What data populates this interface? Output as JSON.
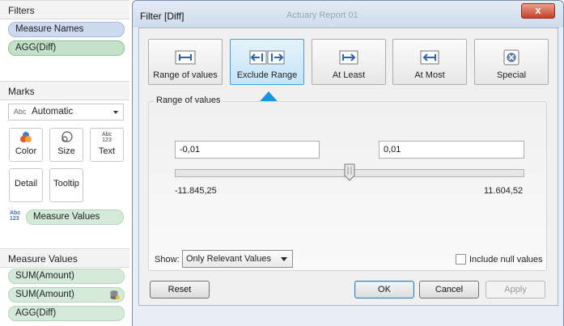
{
  "left_panel": {
    "filters": {
      "title": "Filters",
      "pills": [
        "Measure Names",
        "AGG(Diff)"
      ]
    },
    "marks": {
      "title": "Marks",
      "type_select": {
        "prefix": "Abc",
        "value": "Automatic"
      },
      "buttons": {
        "color": "Color",
        "size": "Size",
        "text": "Text",
        "text_icon_top": "Abc",
        "text_icon_bottom": "123",
        "detail": "Detail",
        "tooltip": "Tooltip"
      },
      "measure_values_abc_top": "Abc",
      "measure_values_abc_bottom": "123",
      "measure_values_pill": "Measure Values"
    },
    "measure_values": {
      "title": "Measure Values",
      "pills": [
        "SUM(Amount)",
        "SUM(Amount)",
        "AGG(Diff)"
      ]
    }
  },
  "dialog": {
    "title": "Filter [Diff]",
    "ghost_title": "Actuary Report 01",
    "close_label": "x",
    "tabs": [
      {
        "label": "Range of values",
        "selected": false
      },
      {
        "label": "Exclude Range",
        "selected": true
      },
      {
        "label": "At Least",
        "selected": false
      },
      {
        "label": "At Most",
        "selected": false
      },
      {
        "label": "Special",
        "selected": false
      }
    ],
    "range_group": {
      "label": "Range of values",
      "min_input": "-0,01",
      "max_input": "0,01",
      "slider_min": "-11.845,25",
      "slider_max": "11.604,52",
      "thumb_position_fraction": 0.5
    },
    "show": {
      "label": "Show:",
      "value": "Only Relevant Values"
    },
    "include_null": {
      "label": "Include null values",
      "checked": false
    },
    "buttons": {
      "reset": "Reset",
      "ok": "OK",
      "cancel": "Cancel",
      "apply": "Apply"
    }
  },
  "colors": {
    "selected_tab_border": "#3c9ee2",
    "blue_arrow": "#1497e3",
    "close_button": "#c6412a",
    "pill_blue": "#cdd9ef",
    "pill_green": "#c3e2c9"
  }
}
